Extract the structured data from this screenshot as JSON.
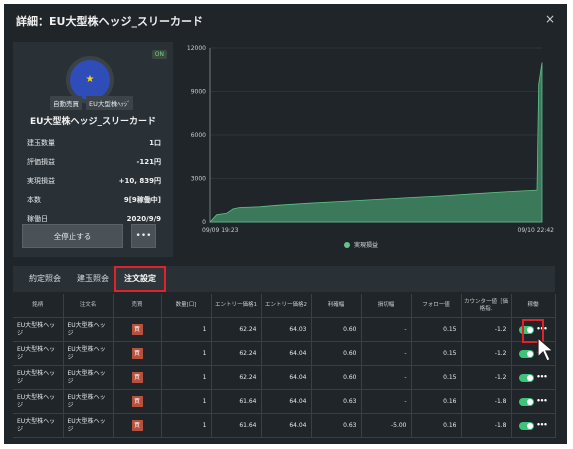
{
  "dialog": {
    "title": "詳細：EU大型株ヘッジ_スリーカード",
    "close_label": "×"
  },
  "strategy": {
    "status_badge": "ON",
    "flag_symbol": "★",
    "tags": [
      "自動売買",
      "EU大型株ﾍｯｼﾞ"
    ],
    "name": "EU大型株ヘッジ_スリーカード",
    "stats": [
      {
        "label": "建玉数量",
        "value": "1口"
      },
      {
        "label": "評価損益",
        "value": "-121円"
      },
      {
        "label": "実現損益",
        "value": "+10, 839円"
      },
      {
        "label": "本数",
        "value": "9[9稼働中]"
      },
      {
        "label": "稼働日",
        "value": "2020/9/9"
      }
    ],
    "stop_all_label": "全停止する",
    "more_label": "•••"
  },
  "chart_data": {
    "type": "area",
    "x_start_label": "09/09 19:23",
    "x_end_label": "09/10 22:42",
    "ylim": [
      0,
      12000
    ],
    "yticks": [
      0,
      3000,
      6000,
      9000,
      12000
    ],
    "series": [
      {
        "name": "実現損益",
        "color": "#3f8a63",
        "points": [
          [
            0,
            0
          ],
          [
            0.02,
            500
          ],
          [
            0.05,
            600
          ],
          [
            0.07,
            900
          ],
          [
            0.09,
            1000
          ],
          [
            0.15,
            1050
          ],
          [
            0.2,
            1150
          ],
          [
            0.3,
            1300
          ],
          [
            0.4,
            1420
          ],
          [
            0.5,
            1550
          ],
          [
            0.6,
            1680
          ],
          [
            0.7,
            1800
          ],
          [
            0.8,
            1950
          ],
          [
            0.9,
            2100
          ],
          [
            0.985,
            2200
          ],
          [
            0.99,
            9500
          ],
          [
            1.0,
            11000
          ],
          [
            1.0,
            0
          ]
        ]
      }
    ]
  },
  "tabs": [
    {
      "label": "約定照会",
      "active": false
    },
    {
      "label": "建玉照会",
      "active": false
    },
    {
      "label": "注文設定",
      "active": true
    }
  ],
  "order_table": {
    "headers": [
      "銘柄",
      "注文名",
      "売買",
      "数量[口]",
      "エントリー価格1",
      "エントリー価格2",
      "利確幅",
      "損切幅",
      "フォロー値",
      "カウンター値［価格指.",
      "稼働"
    ],
    "rows": [
      {
        "symbol": "EU大型株ヘッジ",
        "order_name": "EU大型株ヘッジ",
        "side": "買",
        "qty": "1",
        "entry1": "62.24",
        "entry2": "64.03",
        "take_profit": "0.60",
        "stop_loss": "-",
        "follow": "0.15",
        "counter": "-1.2"
      },
      {
        "symbol": "EU大型株ヘッジ",
        "order_name": "EU大型株ヘッジ",
        "side": "買",
        "qty": "1",
        "entry1": "62.24",
        "entry2": "64.04",
        "take_profit": "0.60",
        "stop_loss": "-",
        "follow": "0.15",
        "counter": "-1.2"
      },
      {
        "symbol": "EU大型株ヘッジ",
        "order_name": "EU大型株ヘッジ",
        "side": "買",
        "qty": "1",
        "entry1": "62.24",
        "entry2": "64.04",
        "take_profit": "0.60",
        "stop_loss": "-",
        "follow": "0.15",
        "counter": "-1.2"
      },
      {
        "symbol": "EU大型株ヘッジ",
        "order_name": "EU大型株ヘッジ",
        "side": "買",
        "qty": "1",
        "entry1": "61.64",
        "entry2": "64.04",
        "take_profit": "0.63",
        "stop_loss": "-",
        "follow": "0.16",
        "counter": "-1.8"
      },
      {
        "symbol": "EU大型株ヘッジ",
        "order_name": "EU大型株ヘッジ",
        "side": "買",
        "qty": "1",
        "entry1": "61.64",
        "entry2": "64.04",
        "take_profit": "0.63",
        "stop_loss": "-5.00",
        "follow": "0.16",
        "counter": "-1.8"
      }
    ],
    "row_more_label": "•••"
  },
  "colors": {
    "accent_red": "#e0232a",
    "toggle_on": "#3fc27a",
    "area_fill": "#3f8a63"
  }
}
